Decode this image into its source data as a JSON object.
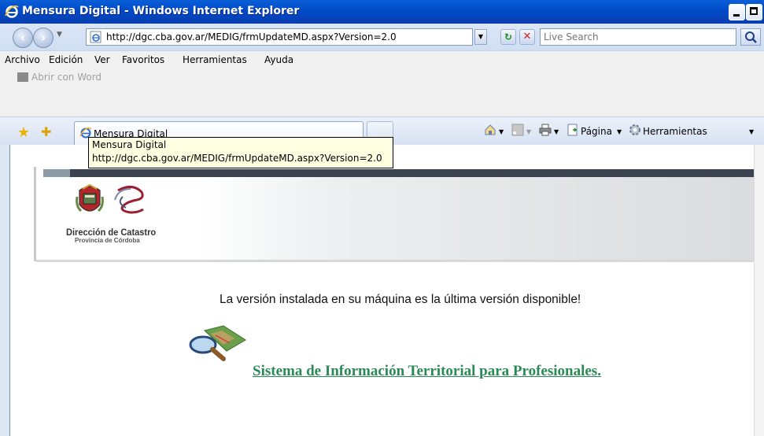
{
  "window": {
    "title": "Mensura Digital - Windows Internet Explorer"
  },
  "address_bar": {
    "url": "http://dgc.cba.gov.ar/MEDIG/frmUpdateMD.aspx?Version=2.0"
  },
  "search": {
    "placeholder": "Live Search"
  },
  "menu": {
    "items": [
      "Archivo",
      "Edición",
      "Ver",
      "Favoritos",
      "Herramientas",
      "Ayuda"
    ]
  },
  "links_bar": {
    "word_label": "Abrir con Word"
  },
  "tabs": {
    "active_label": "Mensura Digital"
  },
  "command_bar": {
    "page_label": "Página",
    "tools_label": "Herramientas"
  },
  "tooltip": {
    "line1": "Mensura Digital",
    "line2": "http://dgc.cba.gov.ar/MEDIG/frmUpdateMD.aspx?Version=2.0"
  },
  "page": {
    "org_name": "Dirección de Catastro",
    "org_sub": "Provincia de Córdoba",
    "message": "La versión instalada en su máquina es la última versión disponible!",
    "link_text": "Sistema de Información Territorial para Profesionales."
  },
  "colors": {
    "titlebar": "#0049c8",
    "link": "#2a8a56",
    "tooltip_bg": "#ffffe1"
  }
}
